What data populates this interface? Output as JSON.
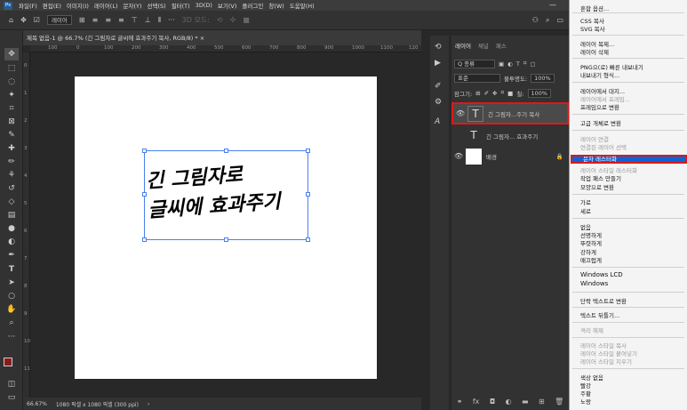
{
  "menubar": {
    "logo": "Ps",
    "items": [
      "파일(F)",
      "편집(E)",
      "이미지(I)",
      "레이어(L)",
      "문자(Y)",
      "선택(S)",
      "필터(T)",
      "3D(D)",
      "보기(V)",
      "플러그인",
      "창(W)",
      "도움말(H)"
    ]
  },
  "options": {
    "layer_select": "레이어",
    "mode_3d": "3D 모드:"
  },
  "document": {
    "tab_title": "제목 없음-1 @ 66.7% (긴 그림자로 글씨에 효과주기 복사, RGB/8) *",
    "close": "×",
    "zoom": "66.67%",
    "size_info": "1080 픽셀 x 1080 픽셀 (300 ppi)",
    "ruler_h": [
      "100",
      "0",
      "100",
      "200",
      "300",
      "400",
      "500",
      "600",
      "700",
      "800",
      "900",
      "1000",
      "1100",
      "120"
    ],
    "ruler_v": [
      "0",
      "1",
      "2",
      "3",
      "4",
      "5",
      "6",
      "7",
      "8",
      "9",
      "10",
      "11"
    ],
    "text_line1": "긴 그림자로",
    "text_line2": "글씨에 효과주기"
  },
  "layers_panel": {
    "tabs": [
      "레이어",
      "채널",
      "패스"
    ],
    "filter": "Q 종류",
    "blend_mode": "표준",
    "opacity_label": "불투명도:",
    "opacity": "100%",
    "lock_label": "잠그기:",
    "fill_label": "칠:",
    "fill": "100%",
    "layers": [
      {
        "name": "긴 그림자...주기 복사",
        "type": "text",
        "visible": true
      },
      {
        "name": "긴 그림자... 효과주기",
        "type": "text",
        "visible": false
      },
      {
        "name": "배경",
        "type": "raster",
        "visible": true
      }
    ],
    "footer_fx": "fx"
  },
  "context_menu": {
    "items": [
      {
        "label": "혼합 옵션...",
        "disabled": false
      },
      {
        "label": "CSS 복사",
        "disabled": false
      },
      {
        "label": "SVG 복사",
        "disabled": false
      },
      {
        "label": "레이어 복제...",
        "disabled": false
      },
      {
        "label": "레이어 삭제",
        "disabled": false
      },
      {
        "label": "PNG으(로) 빠른 내보내기",
        "disabled": false
      },
      {
        "label": "내보내기 형식...",
        "disabled": false
      },
      {
        "label": "레이어에서 대지...",
        "disabled": false
      },
      {
        "label": "레이어에서 프레임...",
        "disabled": true
      },
      {
        "label": "프레임으로 변환",
        "disabled": false
      },
      {
        "label": "고급 개체로 변환",
        "disabled": false
      },
      {
        "label": "레이어 연결",
        "disabled": true
      },
      {
        "label": "연결된 레이어 선택",
        "disabled": true
      },
      {
        "label": "문자 래스터화",
        "disabled": false
      },
      {
        "label": "레이어 스타일 래스터화",
        "disabled": true
      },
      {
        "label": "작업 패스 만들기",
        "disabled": false
      },
      {
        "label": "모양으로 변환",
        "disabled": false
      },
      {
        "label": "가로",
        "disabled": false
      },
      {
        "label": "세로",
        "disabled": false
      },
      {
        "label": "없음",
        "disabled": false
      },
      {
        "label": "선명하게",
        "disabled": false
      },
      {
        "label": "뚜렷하게",
        "disabled": false
      },
      {
        "label": "강하게",
        "disabled": false
      },
      {
        "label": "매끄럽게",
        "disabled": false
      },
      {
        "label": "Windows LCD",
        "disabled": false
      },
      {
        "label": "Windows",
        "disabled": false
      },
      {
        "label": "단락 텍스트로 변환",
        "disabled": false
      },
      {
        "label": "텍스트 뒤틀기...",
        "disabled": false
      },
      {
        "label": "격리 해제",
        "disabled": true
      },
      {
        "label": "레이어 스타일 복사",
        "disabled": true
      },
      {
        "label": "레이어 스타일 붙여넣기",
        "disabled": true
      },
      {
        "label": "레이어 스타일 지우기",
        "disabled": true
      },
      {
        "label": "색상 없음",
        "disabled": false
      },
      {
        "label": "빨강",
        "disabled": false
      },
      {
        "label": "주황",
        "disabled": false
      },
      {
        "label": "노랑",
        "disabled": false
      }
    ]
  },
  "colors": {
    "accent": "#0a64d8",
    "highlight_box": "#e01818",
    "selection": "#4a7ff0"
  }
}
